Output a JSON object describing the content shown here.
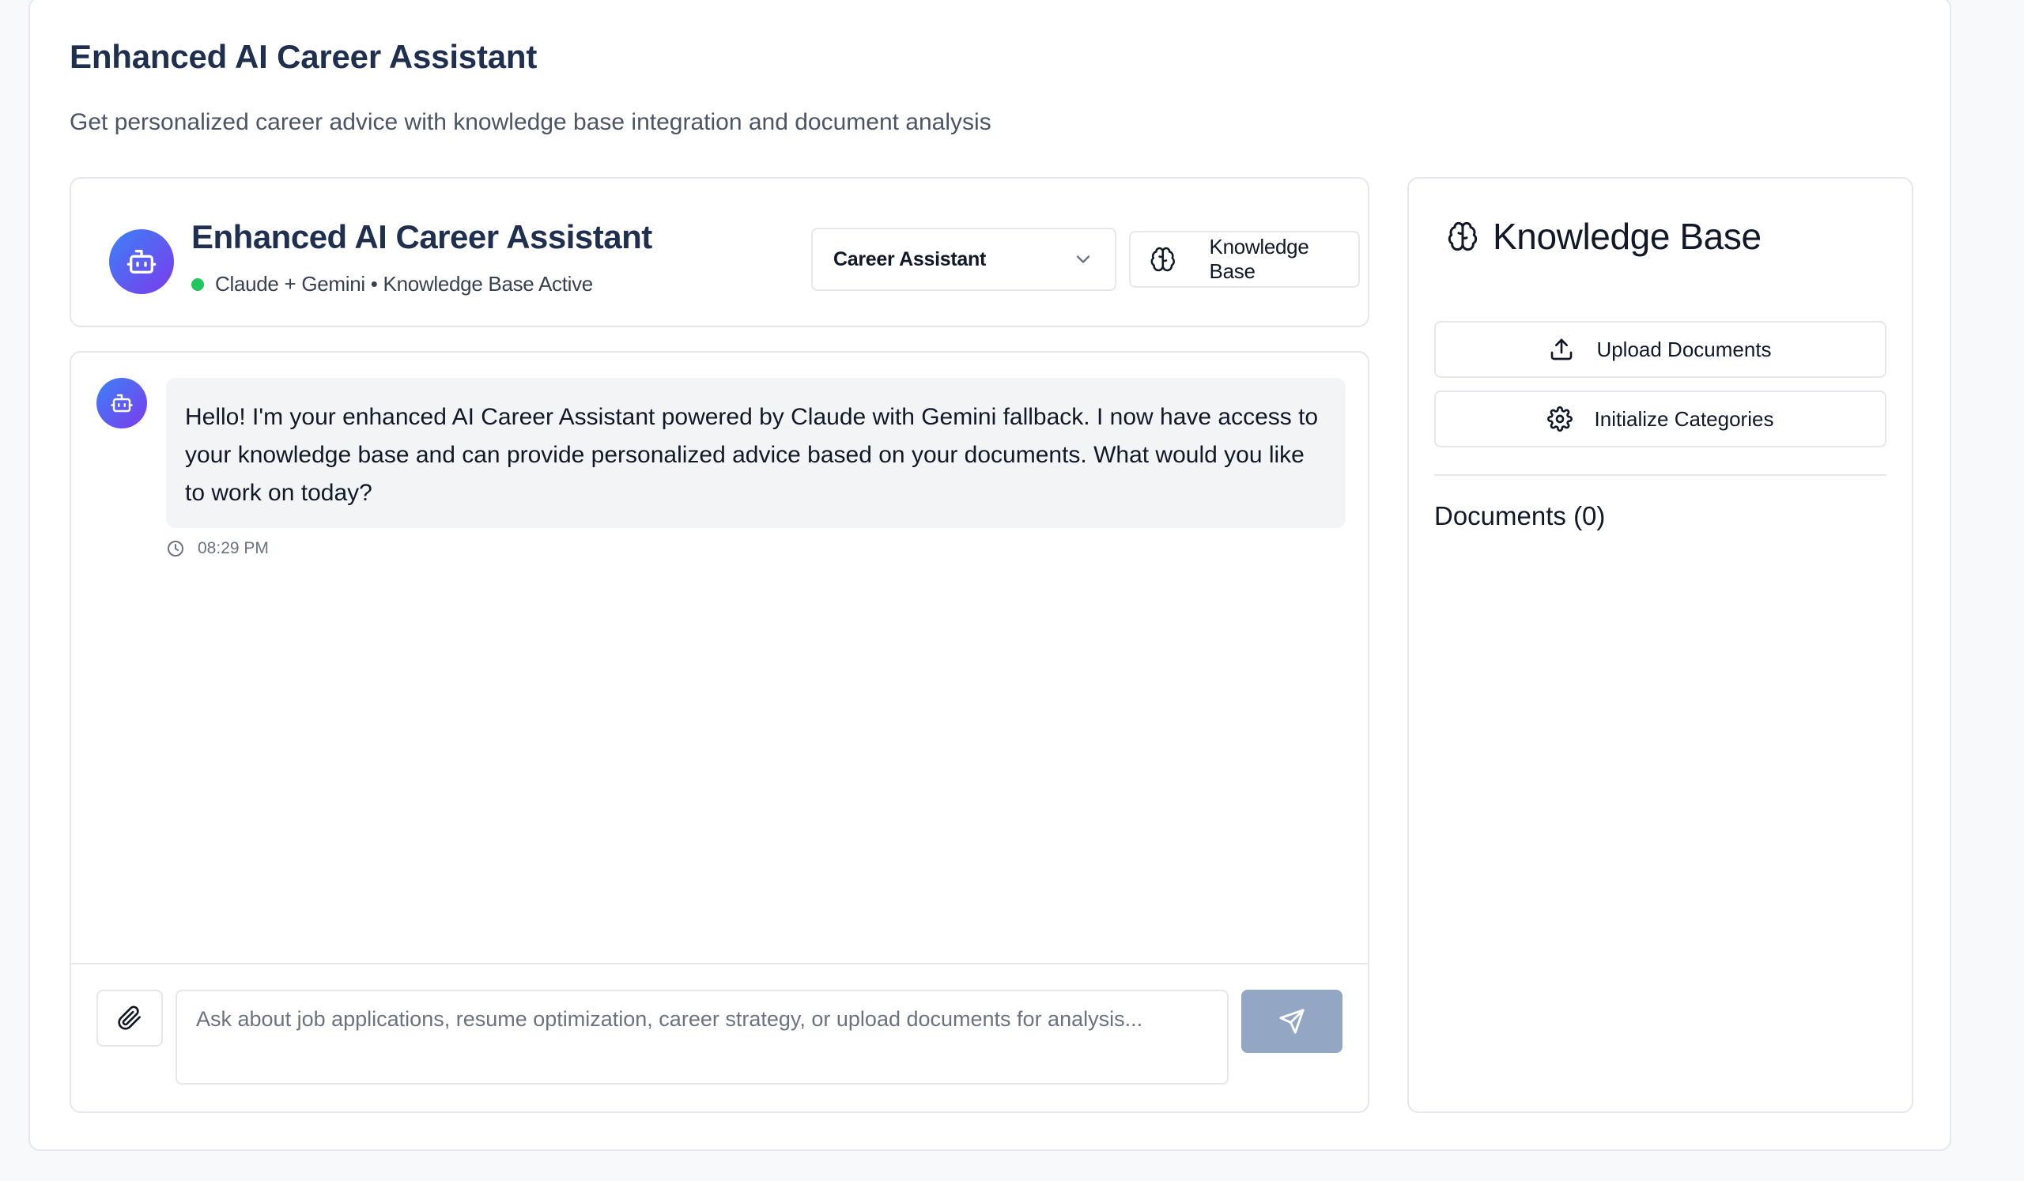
{
  "page": {
    "title": "Enhanced AI Career Assistant",
    "subtitle": "Get personalized career advice with knowledge base integration and document analysis"
  },
  "assistant_header": {
    "name": "Enhanced AI Career Assistant",
    "status": "Claude + Gemini • Knowledge Base Active",
    "status_color": "#22c55e",
    "mode_select": {
      "selected": "Career Assistant"
    },
    "knowledge_base_button": "Knowledge Base"
  },
  "chat": {
    "messages": [
      {
        "role": "assistant",
        "text": "Hello! I'm your enhanced AI Career Assistant powered by Claude with Gemini fallback. I now have access to your knowledge base and can provide personalized advice based on your documents. What would you like to work on today?",
        "time": "08:29 PM"
      }
    ],
    "input_placeholder": "Ask about job applications, resume optimization, career strategy, or upload documents for analysis..."
  },
  "knowledge_base": {
    "title": "Knowledge Base",
    "upload_label": "Upload Documents",
    "initialize_label": "Initialize Categories",
    "documents_heading": "Documents (0)"
  },
  "colors": {
    "accent_gradient_start": "#3b82f6",
    "accent_gradient_end": "#7c3aed",
    "send_button": "#93a6c4",
    "title_text": "#1e2f4f"
  }
}
